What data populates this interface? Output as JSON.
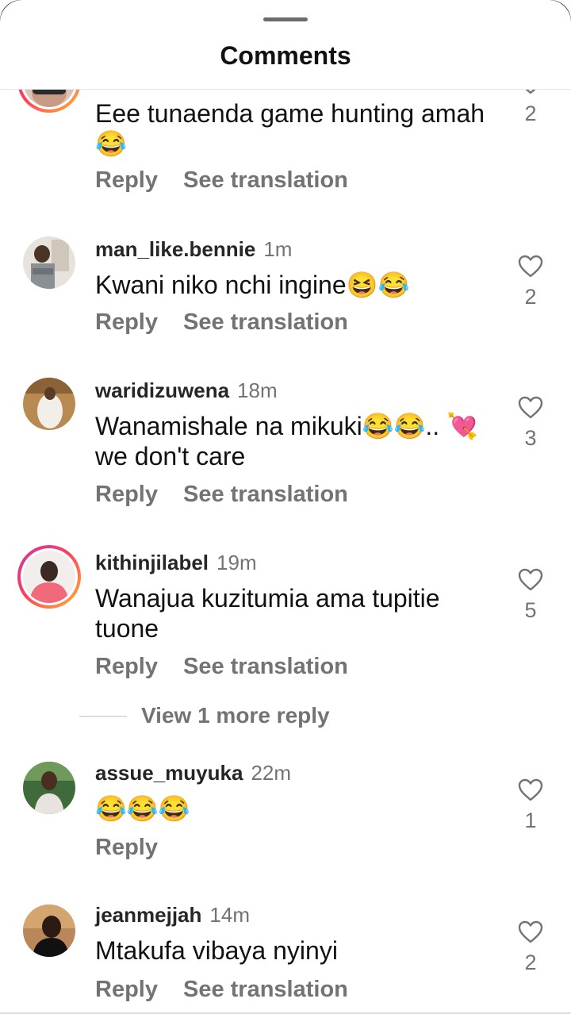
{
  "header": {
    "title": "Comments"
  },
  "comments": [
    {
      "username": "",
      "time": "",
      "text": "Eee tunaenda game hunting amah 😂",
      "reply": "Reply",
      "translate": "See translation",
      "likes": "2"
    },
    {
      "username": "man_like.bennie",
      "time": "1m",
      "text": "Kwani niko nchi ingine😆😂",
      "reply": "Reply",
      "translate": "See translation",
      "likes": "2"
    },
    {
      "username": "waridizuwena",
      "time": "18m",
      "text": "Wanamishale na mikuki😂😂.. 💘 we don't care",
      "reply": "Reply",
      "translate": "See translation",
      "likes": "3"
    },
    {
      "username": "kithinjilabel",
      "time": "19m",
      "text": "Wanajua kuzitumia ama tupitie tuone",
      "reply": "Reply",
      "translate": "See translation",
      "likes": "5"
    },
    {
      "username": "assue_muyuka",
      "time": "22m",
      "text": "😂😂😂",
      "reply": "Reply",
      "translate": "",
      "likes": "1"
    },
    {
      "username": "jeanmejjah",
      "time": "14m",
      "text": "Mtakufa vibaya nyinyi",
      "reply": "Reply",
      "translate": "See translation",
      "likes": "2"
    }
  ],
  "view_more": {
    "label": "View 1 more reply"
  },
  "icons": {
    "like": "heart-outline-icon"
  }
}
